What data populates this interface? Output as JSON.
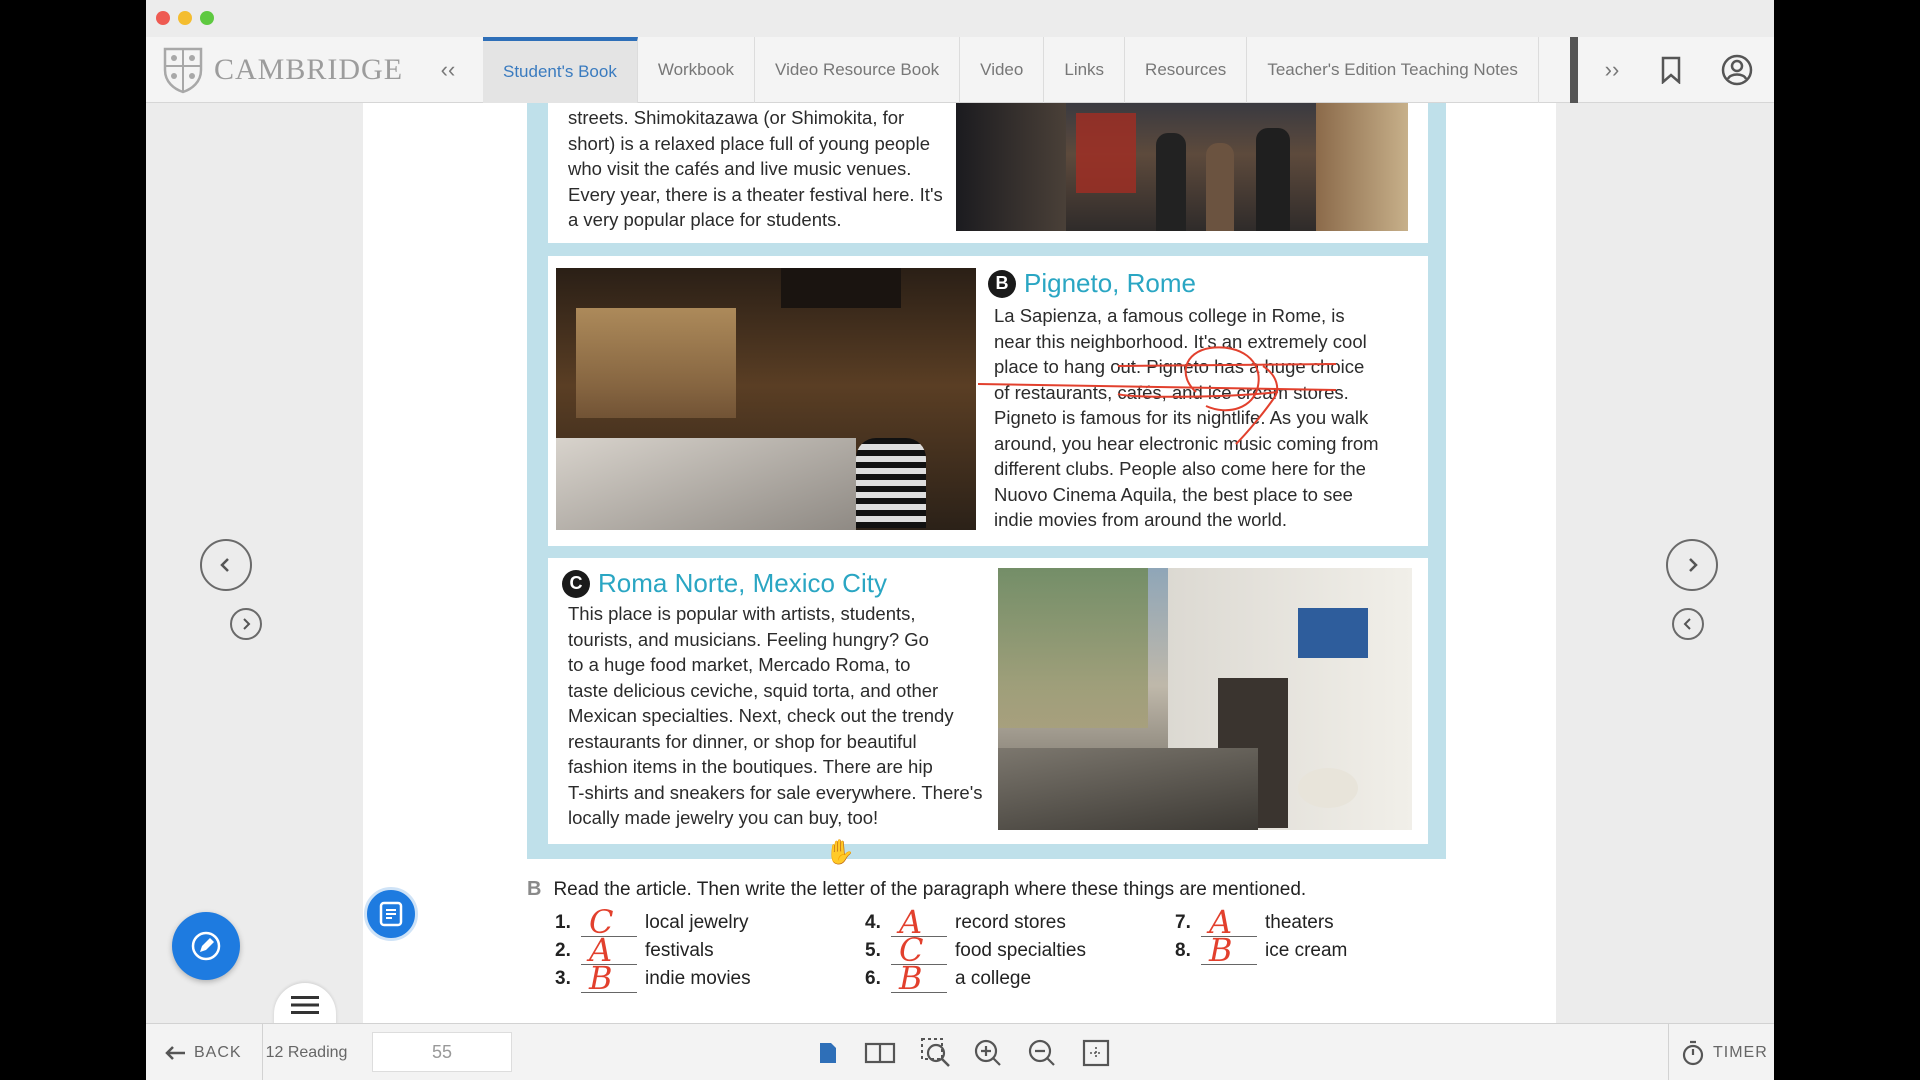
{
  "window": {
    "lights": [
      "#ee5a52",
      "#f4bd2f",
      "#5ec940"
    ]
  },
  "brand": {
    "name": "CAMBRIDGE"
  },
  "nav": {
    "tabs": [
      {
        "label": "Student's Book",
        "active": true
      },
      {
        "label": "Workbook"
      },
      {
        "label": "Video Resource Book"
      },
      {
        "label": "Video"
      },
      {
        "label": "Links"
      },
      {
        "label": "Resources"
      },
      {
        "label": "Teacher's Edition Teaching Notes"
      }
    ],
    "prev_symbol": "‹‹",
    "next_symbol": "››"
  },
  "article": {
    "top_text": "streets. Shimokitazawa (or Shimokita, for short) is a relaxed place full of young people who visit the cafés and live music venues. Every year, there is a theater festival here. It's a very popular place for students.",
    "b": {
      "letter": "B",
      "title": "Pigneto, Rome",
      "lines": [
        "La Sapienza, a famous college in Rome, is",
        "near this neighborhood. It's an extremely cool",
        "place to hang out. Pigneto has a huge choice",
        "of restaurants, cafés, and ice cream stores.",
        "Pigneto is famous for its nightlife. As you walk",
        "around, you hear electronic music coming from",
        "different clubs. People also come here for the",
        "Nuovo Cinema Aquila, the best place to see",
        "indie movies from around the world."
      ]
    },
    "c": {
      "letter": "C",
      "title": "Roma Norte, Mexico City",
      "lines": [
        "This place is popular with artists, students,",
        "tourists, and musicians. Feeling hungry? Go",
        "to a huge food market, Mercado Roma, to",
        "taste delicious ceviche, squid torta, and other",
        "Mexican specialties. Next, check out the trendy",
        "restaurants for dinner, or shop for beautiful",
        "fashion items in the boutiques. There are hip",
        "T-shirts and sneakers for sale everywhere. There's",
        "locally made jewelry you can buy, too!"
      ]
    },
    "annotation_color": "#e2402d"
  },
  "exercise": {
    "letter": "B",
    "instruction": "Read the article. Then write the letter of the paragraph where these things are mentioned.",
    "items": [
      {
        "num": "1.",
        "answer": "C",
        "text": "local jewelry"
      },
      {
        "num": "2.",
        "answer": "A",
        "text": "festivals"
      },
      {
        "num": "3.",
        "answer": "B",
        "text": "indie movies"
      },
      {
        "num": "4.",
        "answer": "A",
        "text": "record stores"
      },
      {
        "num": "5.",
        "answer": "C",
        "text": "food specialties"
      },
      {
        "num": "6.",
        "answer": "B",
        "text": "a college"
      },
      {
        "num": "7.",
        "answer": "A",
        "text": "theaters"
      },
      {
        "num": "8.",
        "answer": "B",
        "text": "ice cream"
      }
    ]
  },
  "bottom": {
    "back": "BACK",
    "unit": "12 Reading",
    "page_number": "55",
    "timer": "TIMER"
  },
  "colors": {
    "accent": "#2e6fb8",
    "fab": "#1e7be0",
    "panel_bg": "#bfe0ea",
    "heading": "#2aa6c3"
  }
}
